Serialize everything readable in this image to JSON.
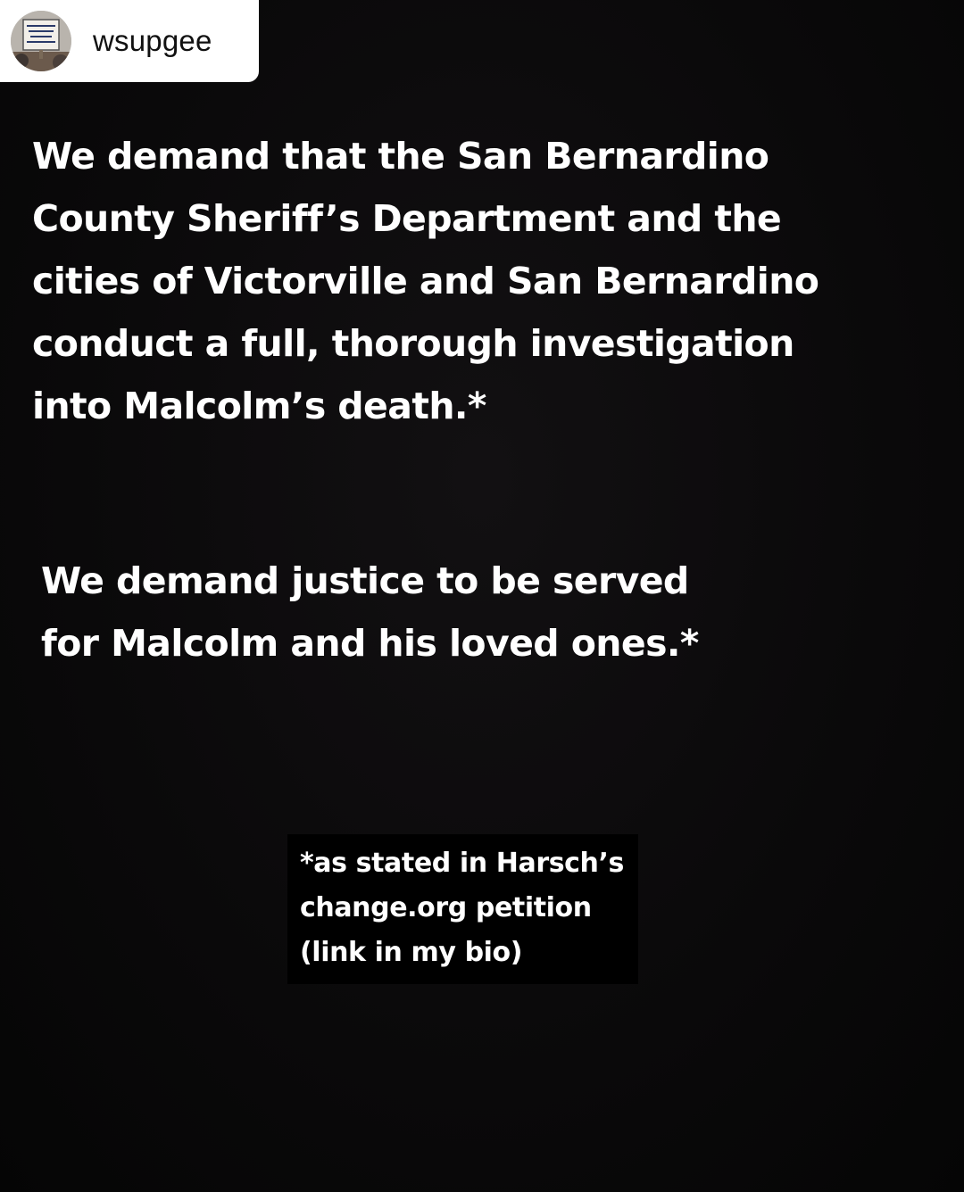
{
  "repost": {
    "username": "wsupgee",
    "avatar_icon": "protest-sign-avatar"
  },
  "headline": {
    "lines": [
      "We demand that the San Bernardino",
      "County Sheriff’s Department and the",
      "cities of Victorville and San Bernardino",
      "conduct a full, thorough investigation",
      "into Malcolm’s death.*"
    ]
  },
  "second_statement": {
    "lines": [
      "We demand justice to be served",
      "for Malcolm and his loved ones.*"
    ]
  },
  "footnote": {
    "lines": [
      "*as stated in Harsch’s",
      "change.org petition",
      "(link in my bio)"
    ]
  },
  "colors": {
    "background": "#080808",
    "text": "#ffffff",
    "header_background": "#ffffff",
    "username_text": "#111111"
  }
}
